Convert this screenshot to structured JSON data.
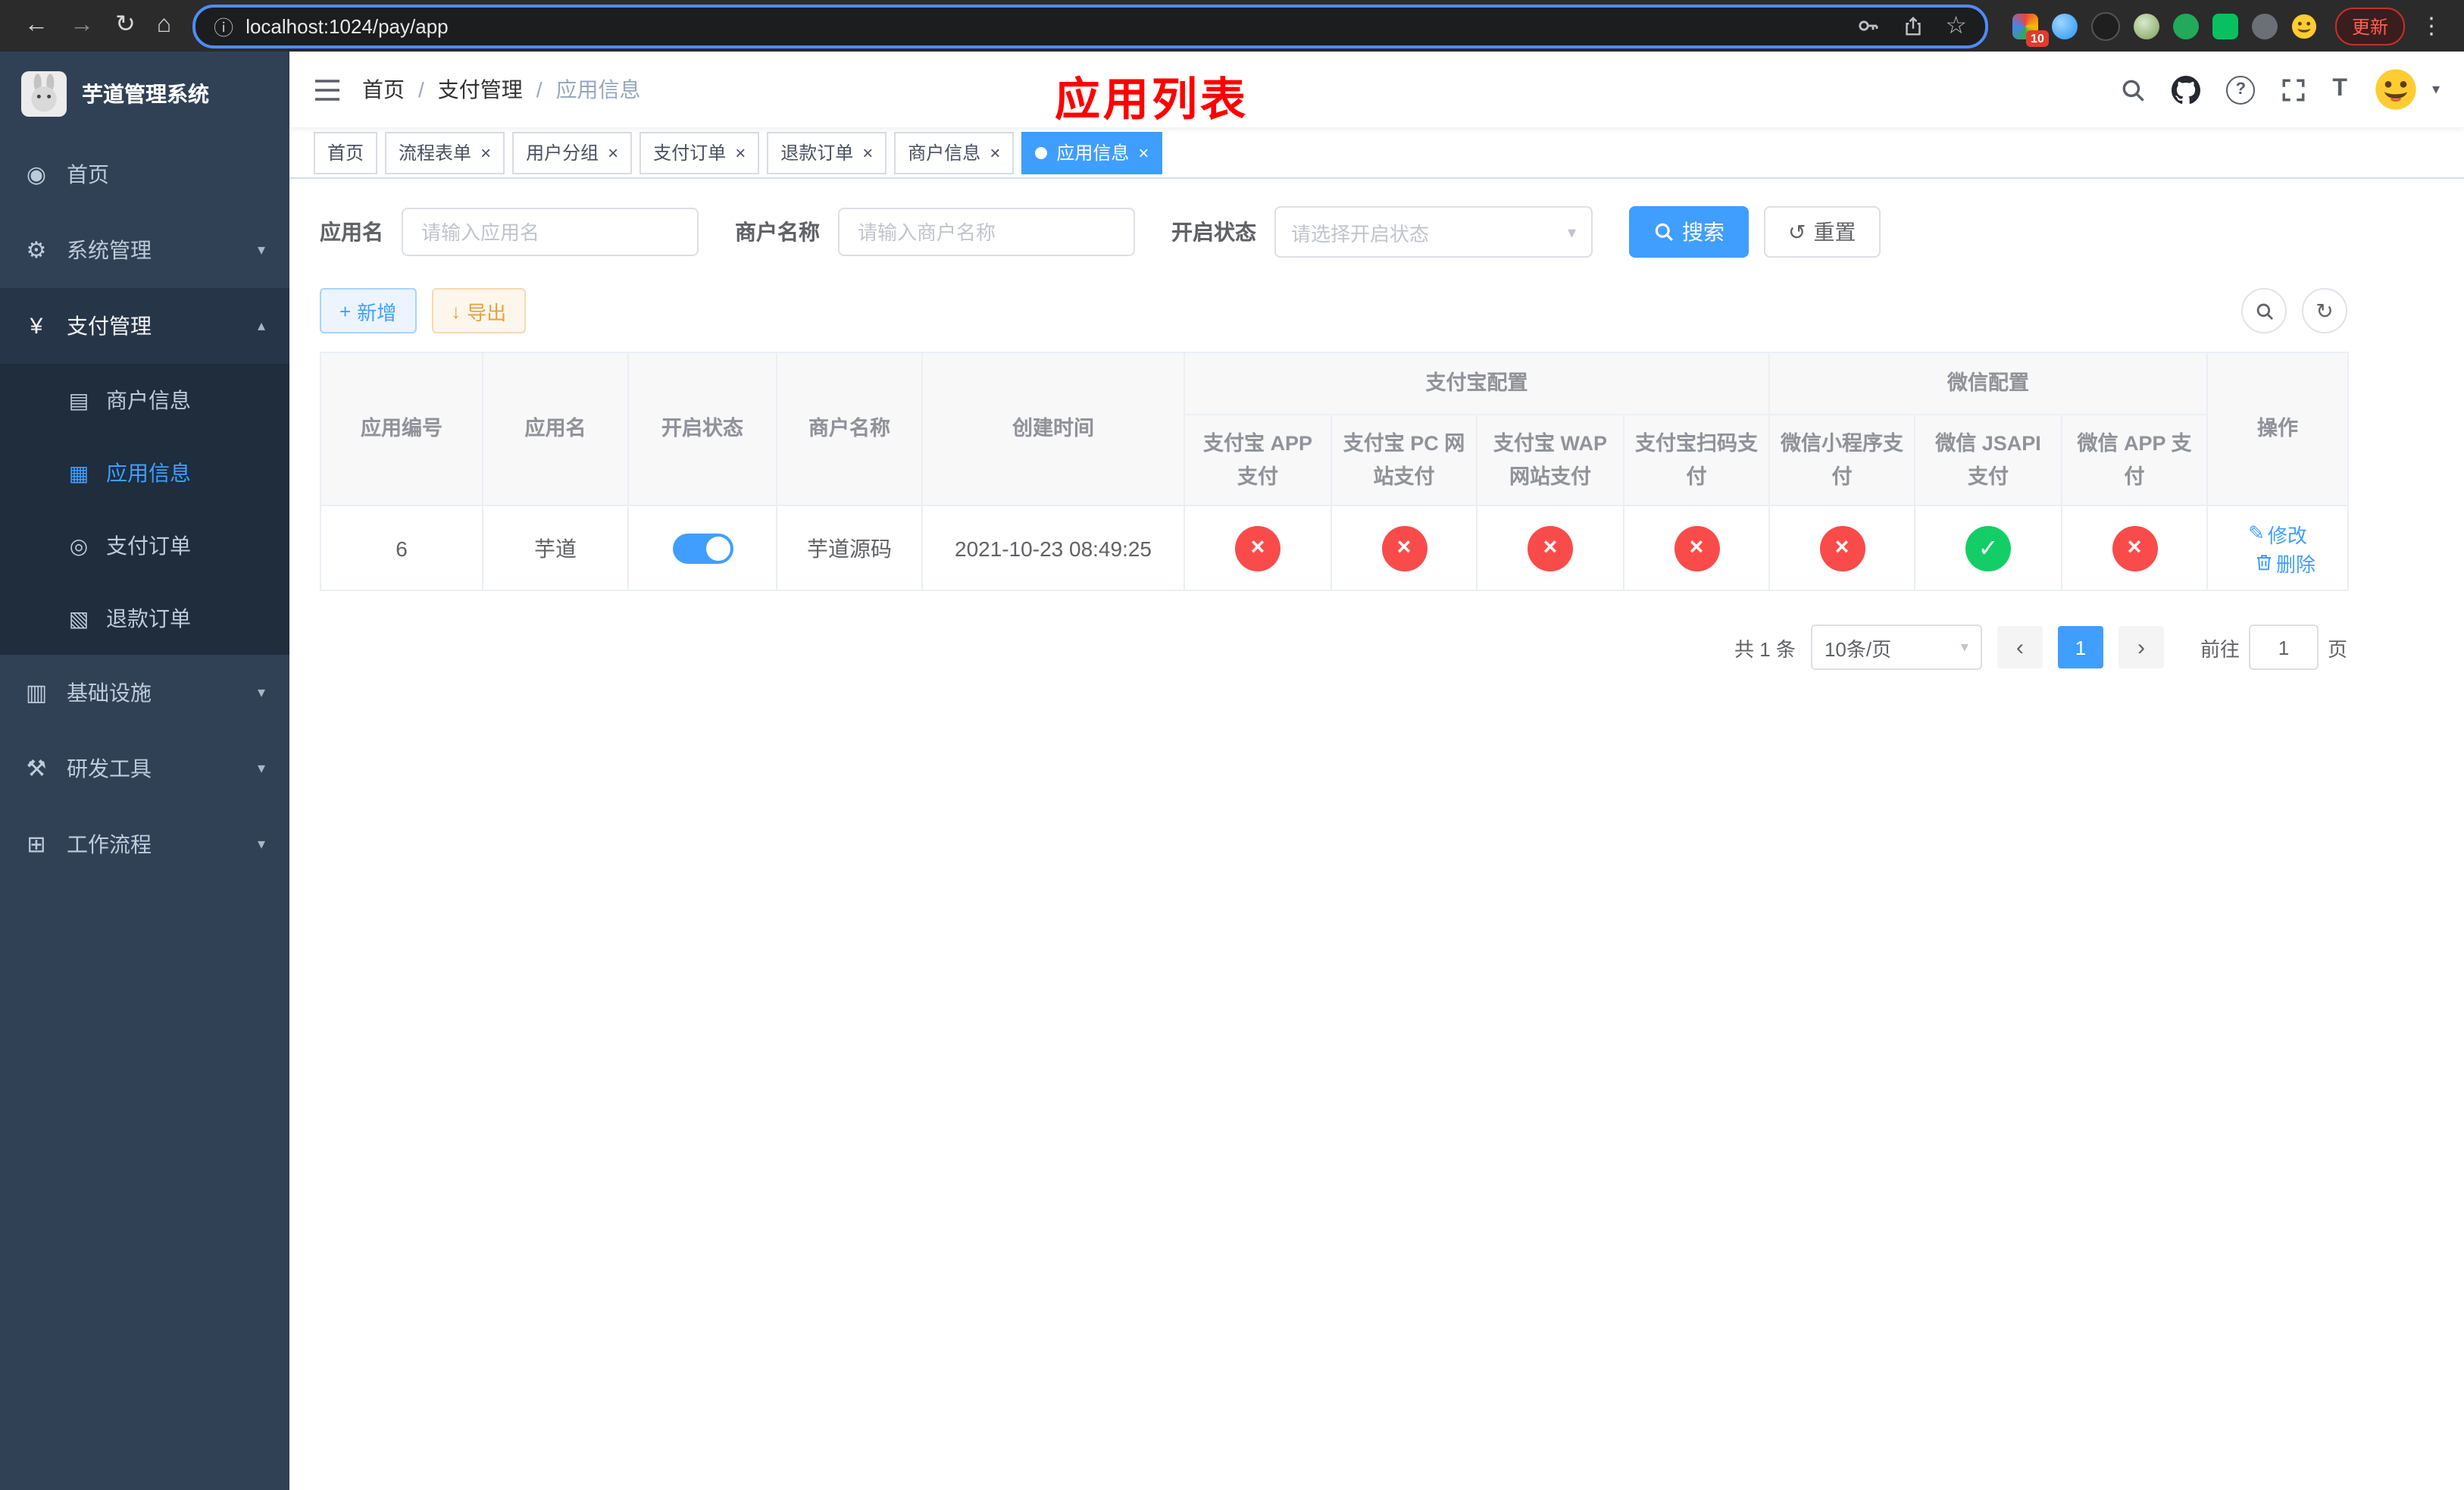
{
  "colors": {
    "accent": "#409eff",
    "danger": "#fa4b4b",
    "success": "#13ce66",
    "warning": "#e6a23c",
    "annotation_red": "#ff0000",
    "sidebar_bg": "#304156",
    "submenu_bg": "#1f2d3d"
  },
  "browser": {
    "url": "localhost:1024/pay/app",
    "update_label": "更新",
    "extension_badge": "10"
  },
  "icons": {
    "back": "←",
    "forward": "→",
    "reload": "↻",
    "home": "⌂",
    "info": "ⓘ",
    "star": "☆",
    "kebab": "⋮",
    "caret_down": "▾",
    "chevron_down": "▾",
    "chevron_up": "▴",
    "plus": "+",
    "download": "↓",
    "reset": "↺",
    "refresh": "↻",
    "close": "×",
    "dashboard": "◉",
    "gear": "⚙",
    "yen": "¥",
    "merchant": "▤",
    "app": "▦",
    "pay_order": "◎",
    "refund_order": "▧",
    "infra": "▥",
    "tools": "⚒",
    "workflow": "⊞",
    "edit": "✎",
    "check": "✓",
    "cross": "×",
    "prev": "‹",
    "next": "›",
    "font_size": "T"
  },
  "sidebar": {
    "title": "芋道管理系统",
    "items": [
      {
        "label": "首页"
      },
      {
        "label": "系统管理"
      },
      {
        "label": "支付管理"
      },
      {
        "label": "基础设施"
      },
      {
        "label": "研发工具"
      },
      {
        "label": "工作流程"
      }
    ],
    "pay_children": [
      {
        "label": "商户信息"
      },
      {
        "label": "应用信息"
      },
      {
        "label": "支付订单"
      },
      {
        "label": "退款订单"
      }
    ]
  },
  "header": {
    "breadcrumb": [
      "首页",
      "支付管理",
      "应用信息"
    ],
    "sep": "/",
    "overlay_title": "应用列表"
  },
  "tabs": [
    {
      "label": "首页"
    },
    {
      "label": "流程表单"
    },
    {
      "label": "用户分组"
    },
    {
      "label": "支付订单"
    },
    {
      "label": "退款订单"
    },
    {
      "label": "商户信息"
    },
    {
      "label": "应用信息"
    }
  ],
  "filters": {
    "app_name_label": "应用名",
    "app_name_placeholder": "请输入应用名",
    "merchant_label": "商户名称",
    "merchant_placeholder": "请输入商户名称",
    "status_label": "开启状态",
    "status_placeholder": "请选择开启状态",
    "search_label": "搜索",
    "reset_label": "重置"
  },
  "toolbar": {
    "add_label": "新增",
    "export_label": "导出"
  },
  "table": {
    "groups": {
      "alipay": "支付宝配置",
      "wechat": "微信配置"
    },
    "columns": {
      "id": "应用编号",
      "name": "应用名",
      "status": "开启状态",
      "merchant": "商户名称",
      "created": "创建时间",
      "alipay_app": "支付宝 APP 支付",
      "alipay_pc": "支付宝 PC 网站支付",
      "alipay_wap": "支付宝 WAP 网站支付",
      "alipay_qr": "支付宝扫码支付",
      "wx_mini": "微信小程序支付",
      "wx_jsapi": "微信 JSAPI 支付",
      "wx_app": "微信 APP 支付",
      "actions": "操作"
    },
    "rows": [
      {
        "id": "6",
        "name": "芋道",
        "status_on": true,
        "merchant": "芋道源码",
        "created": "2021-10-23 08:49:25",
        "configs": [
          "no",
          "no",
          "no",
          "no",
          "no",
          "yes",
          "no"
        ],
        "edit_label": "修改",
        "delete_label": "删除"
      }
    ]
  },
  "pagination": {
    "total": "共 1 条",
    "page_size": "10条/页",
    "page": "1",
    "goto_label": "前往",
    "goto_value": "1",
    "page_unit": "页"
  }
}
